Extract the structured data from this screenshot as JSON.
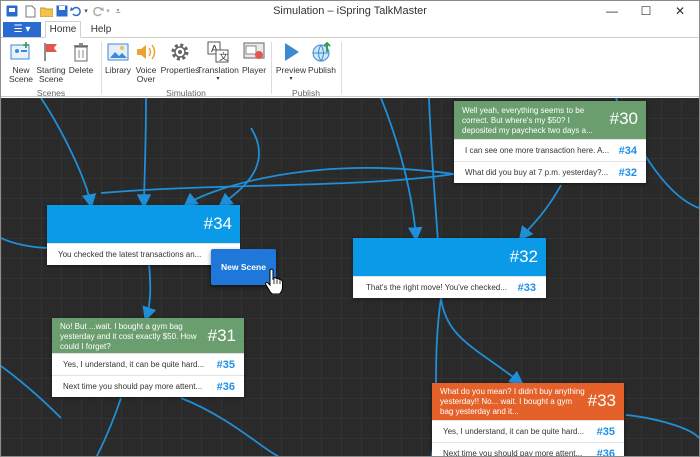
{
  "titlebar": {
    "title": "Simulation – iSpring TalkMaster",
    "minimize_label": "—",
    "maximize_label": "☐",
    "close_label": "✕"
  },
  "tabs": {
    "file_label": "☰ ▾",
    "home": "Home",
    "help": "Help"
  },
  "ribbon": {
    "new_scene": "New\nScene",
    "starting_scene": "Starting\nScene",
    "delete": "Delete",
    "library": "Library",
    "voice_over": "Voice\nOver",
    "properties": "Properties",
    "translation": "Translation",
    "player": "Player",
    "preview": "Preview",
    "publish": "Publish",
    "group_scenes": "Scenes",
    "group_simulation": "Simulation",
    "group_publish": "Publish"
  },
  "colors": {
    "accent": "#2b6bd0",
    "green_scene": "#6a9e6e",
    "blue_scene": "#0a9ae8",
    "orange_scene": "#e4622a",
    "canvas_bg": "#2a2a2a",
    "link_color": "#1f8fd8"
  },
  "scenes": {
    "s30": {
      "number": "#30",
      "text": "Well yeah, everything seems to be correct. But where's my $50? I deposited my paycheck two days a...",
      "replies": [
        {
          "text": "I can see one more transaction here. A...",
          "target": "#34"
        },
        {
          "text": "What did you buy at 7 p.m. yesterday?...",
          "target": "#32"
        }
      ]
    },
    "s34": {
      "number": "#34",
      "text": "",
      "replies": [
        {
          "text": "You checked the latest transactions an...",
          "target": ""
        }
      ]
    },
    "s32": {
      "number": "#32",
      "text": "",
      "replies": [
        {
          "text": "That's the right move! You've checked...",
          "target": "#33"
        }
      ]
    },
    "s31": {
      "number": "#31",
      "text": "No! But ...wait. I bought a gym bag yesterday and it cost exactly $50. How could I forget?",
      "replies": [
        {
          "text": "Yes, I understand, it can be quite hard...",
          "target": "#35"
        },
        {
          "text": "Next time you should pay more attent...",
          "target": "#36"
        }
      ]
    },
    "s33": {
      "number": "#33",
      "text": "What do you mean? I didn't buy anything yesterday!! No... wait. I bought a gym bag yesterday and it...",
      "replies": [
        {
          "text": "Yes, I understand, it can be quite hard...",
          "target": "#35"
        },
        {
          "text": "Next time you should pay more attent...",
          "target": "#36"
        }
      ]
    }
  },
  "drag_button": {
    "label": "New Scene"
  }
}
